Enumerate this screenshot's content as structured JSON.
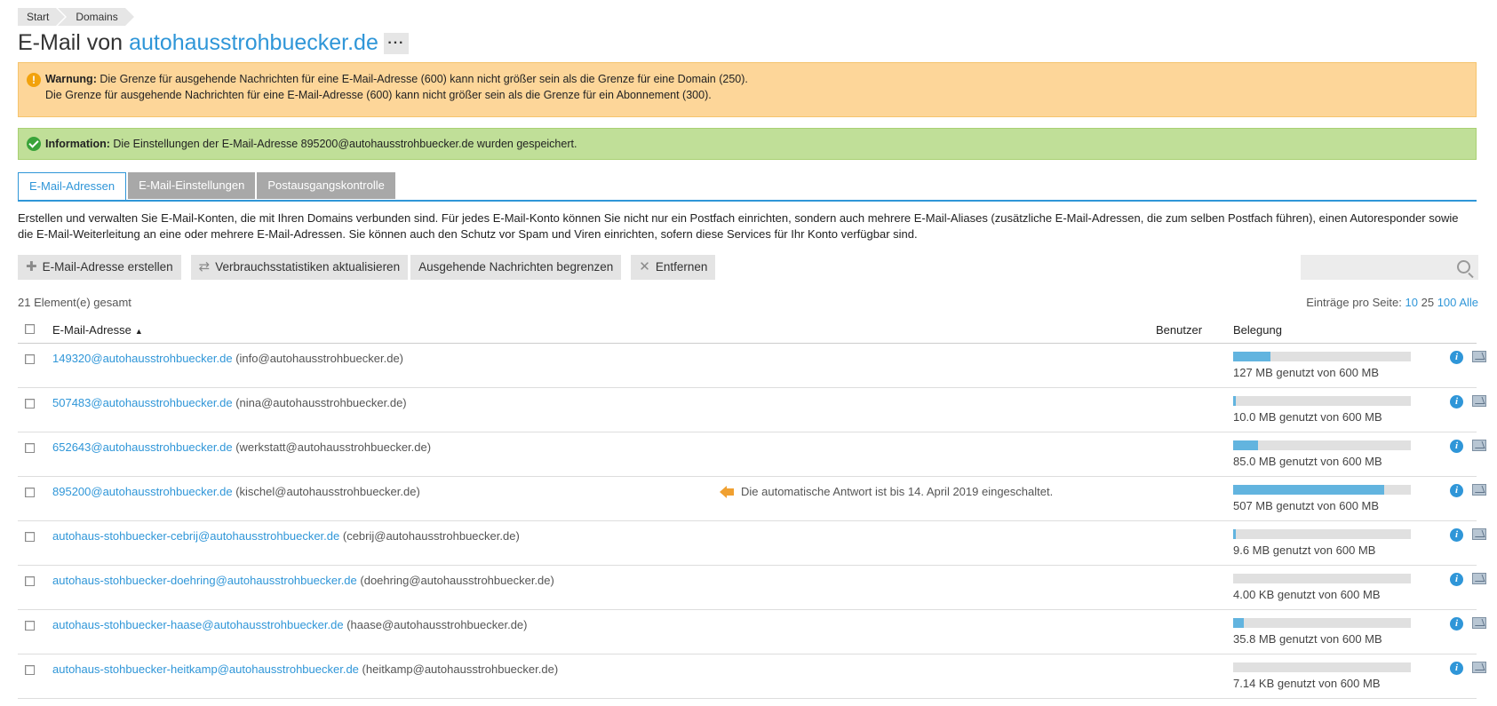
{
  "breadcrumb": [
    "Start",
    "Domains"
  ],
  "title": {
    "prefix": "E-Mail von",
    "domain": "autohausstrohbuecker.de",
    "more": "···"
  },
  "warning": {
    "label": "Warnung:",
    "line1": "Die Grenze für ausgehende Nachrichten für eine E-Mail-Adresse (600) kann nicht größer sein als die Grenze für eine Domain (250).",
    "line2": "Die Grenze für ausgehende Nachrichten für eine E-Mail-Adresse (600) kann nicht größer sein als die Grenze für ein Abonnement (300)."
  },
  "info": {
    "label": "Information:",
    "text": "Die Einstellungen der E-Mail-Adresse 895200@autohausstrohbuecker.de wurden gespeichert."
  },
  "tabs": [
    "E-Mail-Adressen",
    "E-Mail-Einstellungen",
    "Postausgangskontrolle"
  ],
  "description": "Erstellen und verwalten Sie E-Mail-Konten, die mit Ihren Domains verbunden sind. Für jedes E-Mail-Konto können Sie nicht nur ein Postfach einrichten, sondern auch mehrere E-Mail-Aliases (zusätzliche E-Mail-Adressen, die zum selben Postfach führen), einen Autoresponder sowie die E-Mail-Weiterleitung an eine oder mehrere E-Mail-Adressen. Sie können auch den Schutz vor Spam und Viren einrichten, sofern diese Services für Ihr Konto verfügbar sind.",
  "toolbar": {
    "create": "E-Mail-Adresse erstellen",
    "refresh": "Verbrauchsstatistiken aktualisieren",
    "limit": "Ausgehende Nachrichten begrenzen",
    "remove": "Entfernen"
  },
  "list": {
    "total": "21 Element(e) gesamt",
    "per_page_label": "Einträge pro Seite:",
    "per_page_options": [
      "10",
      "25",
      "100",
      "Alle"
    ]
  },
  "columns": {
    "email": "E-Mail-Adresse",
    "user": "Benutzer",
    "usage": "Belegung"
  },
  "rows": [
    {
      "email": "149320@autohausstrohbuecker.de",
      "alias": "(info@autohausstrohbuecker.de)",
      "note": "",
      "used": "127 MB genutzt von 600 MB",
      "fraction": 0.21
    },
    {
      "email": "507483@autohausstrohbuecker.de",
      "alias": "(nina@autohausstrohbuecker.de)",
      "note": "",
      "used": "10.0 MB genutzt von 600 MB",
      "fraction": 0.017
    },
    {
      "email": "652643@autohausstrohbuecker.de",
      "alias": "(werkstatt@autohausstrohbuecker.de)",
      "note": "",
      "used": "85.0 MB genutzt von 600 MB",
      "fraction": 0.14
    },
    {
      "email": "895200@autohausstrohbuecker.de",
      "alias": "(kischel@autohausstrohbuecker.de)",
      "note": "Die automatische Antwort ist bis 14. April 2019 eingeschaltet.",
      "used": "507 MB genutzt von 600 MB",
      "fraction": 0.85
    },
    {
      "email": "autohaus-stohbuecker-cebrij@autohausstrohbuecker.de",
      "alias": "(cebrij@autohausstrohbuecker.de)",
      "note": "",
      "used": "9.6 MB genutzt von 600 MB",
      "fraction": 0.016
    },
    {
      "email": "autohaus-stohbuecker-doehring@autohausstrohbuecker.de",
      "alias": "(doehring@autohausstrohbuecker.de)",
      "note": "",
      "used": "4.00 KB genutzt von 600 MB",
      "fraction": 0.0
    },
    {
      "email": "autohaus-stohbuecker-haase@autohausstrohbuecker.de",
      "alias": "(haase@autohausstrohbuecker.de)",
      "note": "",
      "used": "35.8 MB genutzt von 600 MB",
      "fraction": 0.06
    },
    {
      "email": "autohaus-stohbuecker-heitkamp@autohausstrohbuecker.de",
      "alias": "(heitkamp@autohausstrohbuecker.de)",
      "note": "",
      "used": "7.14 KB genutzt von 600 MB",
      "fraction": 0.0
    }
  ],
  "colors": {
    "accent": "#2f96d8",
    "warning_bg": "#fdd699",
    "info_bg": "#c0df98",
    "bar_fill": "#62b4df"
  }
}
